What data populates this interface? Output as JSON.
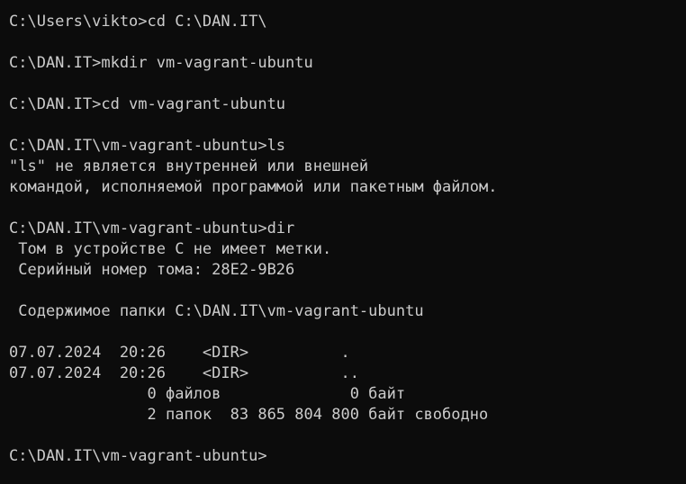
{
  "terminal": {
    "lines": [
      "C:\\Users\\vikto>cd C:\\DAN.IT\\",
      "",
      "C:\\DAN.IT>mkdir vm-vagrant-ubuntu",
      "",
      "C:\\DAN.IT>cd vm-vagrant-ubuntu",
      "",
      "C:\\DAN.IT\\vm-vagrant-ubuntu>ls",
      "\"ls\" не является внутренней или внешней",
      "командой, исполняемой программой или пакетным файлом.",
      "",
      "C:\\DAN.IT\\vm-vagrant-ubuntu>dir",
      " Том в устройстве C не имеет метки.",
      " Серийный номер тома: 28E2-9B26",
      "",
      " Содержимое папки C:\\DAN.IT\\vm-vagrant-ubuntu",
      "",
      "07.07.2024  20:26    <DIR>          .",
      "07.07.2024  20:26    <DIR>          ..",
      "               0 файлов              0 байт",
      "               2 папок  83 865 804 800 байт свободно",
      "",
      "C:\\DAN.IT\\vm-vagrant-ubuntu>"
    ]
  },
  "colors": {
    "background": "#0c0c0c",
    "foreground": "#cccccc"
  }
}
